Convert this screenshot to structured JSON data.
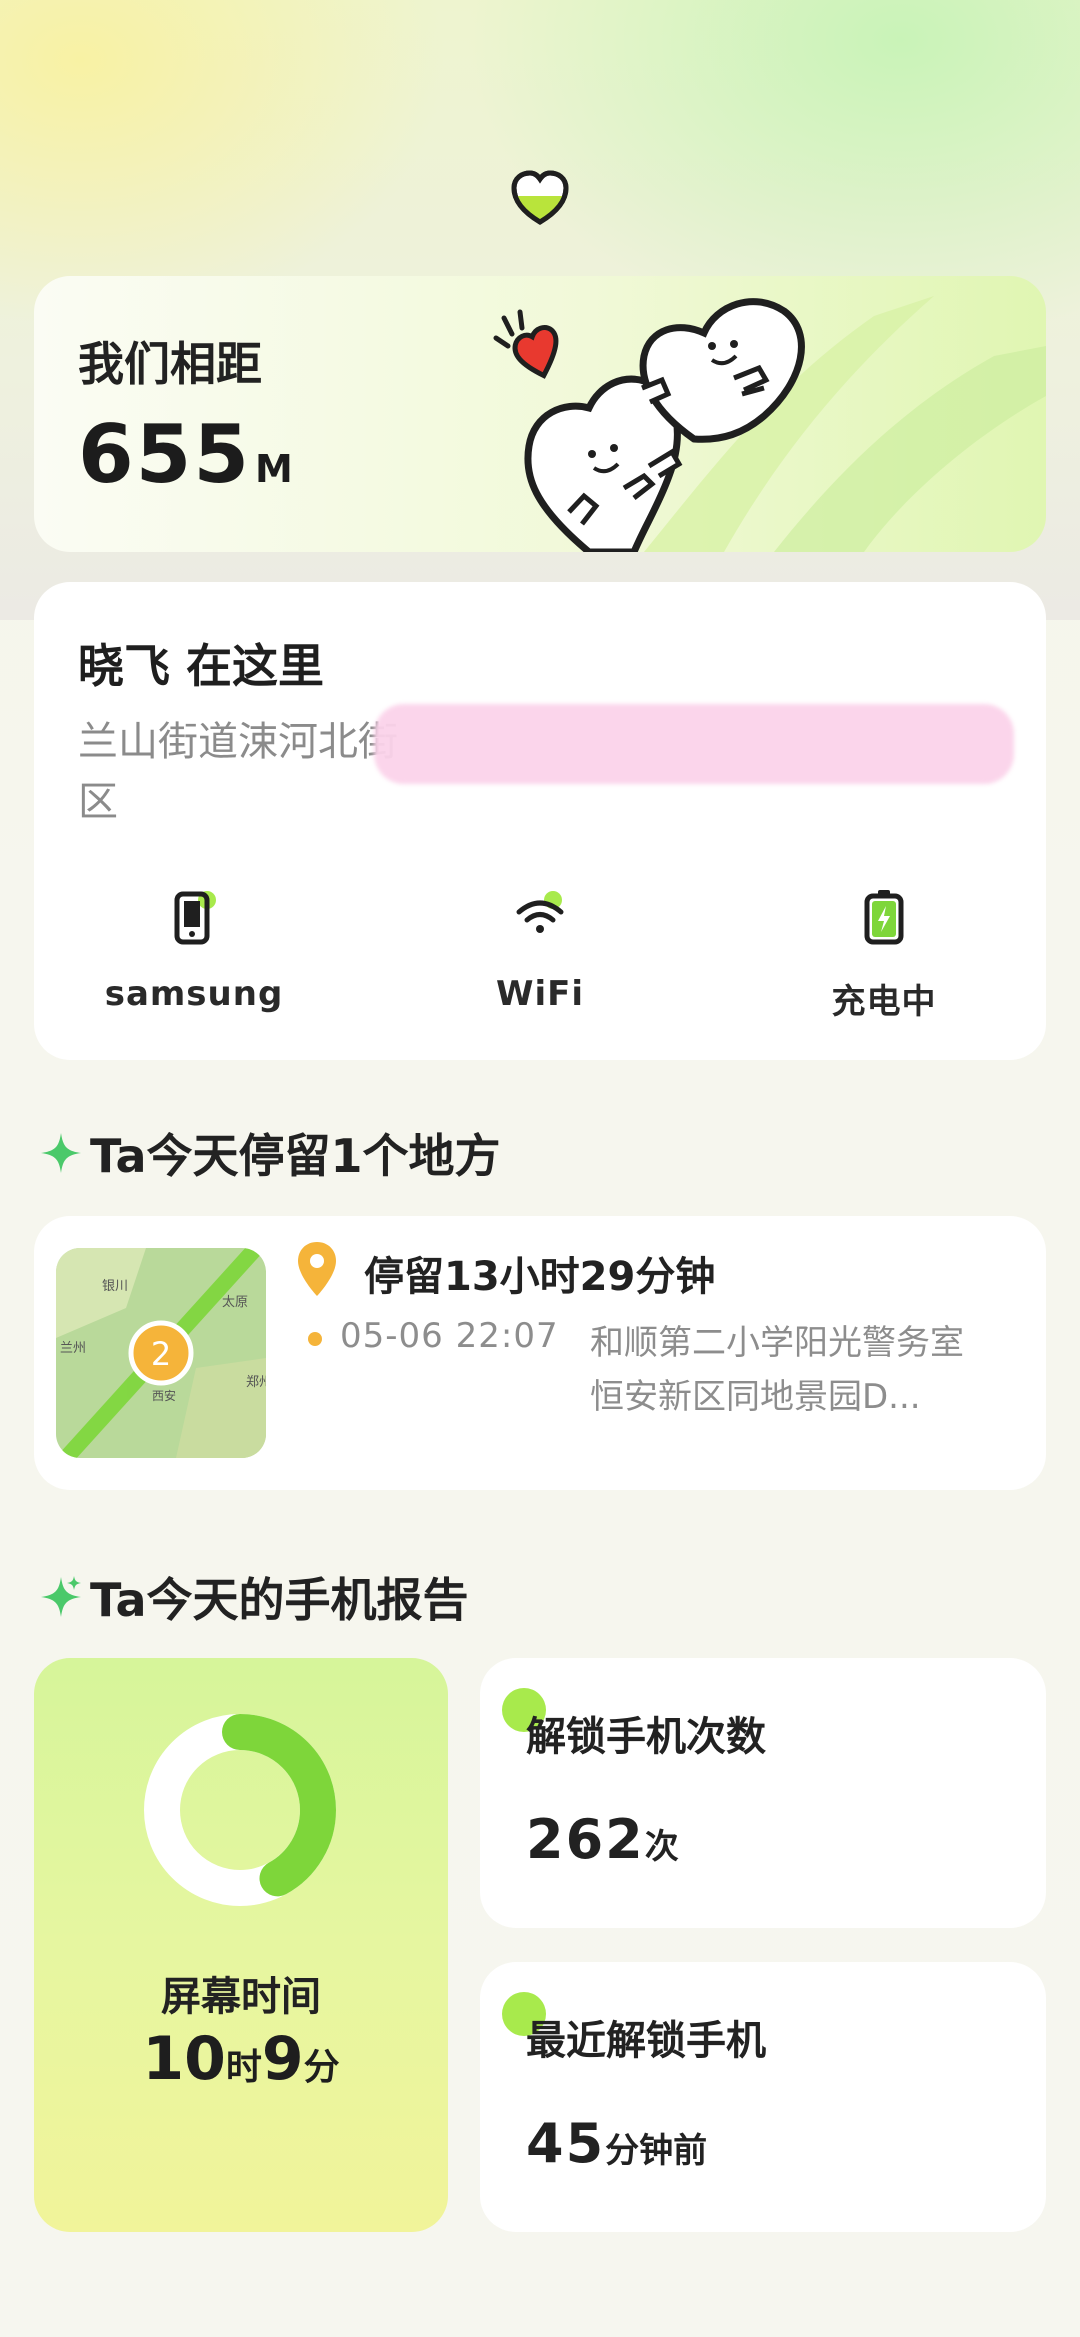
{
  "distance": {
    "title": "我们相距",
    "value": "655",
    "unit": "M"
  },
  "location": {
    "title": "晓飞 在这里",
    "address": "兰山街道涑河北街",
    "address_line2": "区"
  },
  "status": [
    {
      "label": "samsung",
      "icon": "phone-icon"
    },
    {
      "label": "WiFi",
      "icon": "wifi-icon"
    },
    {
      "label": "充电中",
      "icon": "battery-charging-icon"
    }
  ],
  "stay_section": {
    "title": "Ta今天停留1个地方"
  },
  "stay": {
    "cluster_count": "2",
    "duration": "停留13小时29分钟",
    "time": "05-06 22:07",
    "place": "和顺第二小学阳光警务室恒安新区同地景园D...",
    "map_labels": [
      "银川",
      "太原",
      "兰州",
      "郑州",
      "西安"
    ]
  },
  "report_section": {
    "title": "Ta今天的手机报告"
  },
  "screen_time": {
    "label": "屏幕时间",
    "hours": "10",
    "hours_unit": "时",
    "minutes": "9",
    "minutes_unit": "分",
    "ring_fraction": 0.42
  },
  "unlock_count": {
    "title": "解锁手机次数",
    "value": "262",
    "unit": "次"
  },
  "last_unlock": {
    "title": "最近解锁手机",
    "value": "45",
    "unit": "分钟前"
  },
  "colors": {
    "accent_green": "#a8ea4c",
    "ring_green": "#7ed63a",
    "pin_orange": "#f5b43a",
    "heart_red": "#e8392f"
  }
}
